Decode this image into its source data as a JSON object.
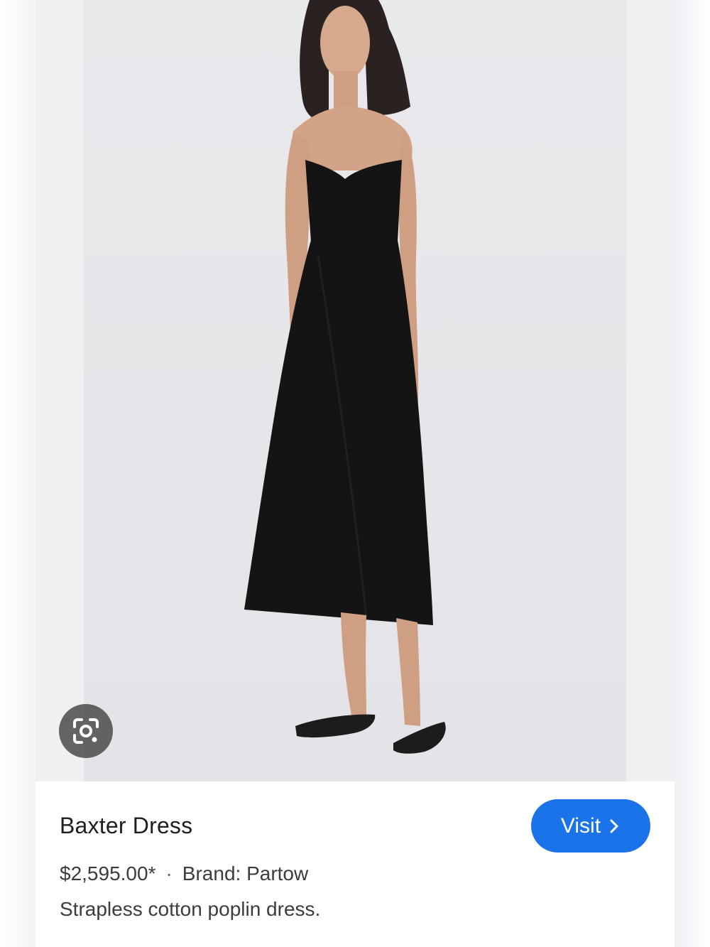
{
  "product": {
    "title": "Baxter Dress",
    "price": "$2,595.00*",
    "separator": "·",
    "brand": "Brand: Partow",
    "description": "Strapless cotton poplin dress."
  },
  "actions": {
    "visit_label": "Visit",
    "visit_icon": "chevron-right-icon",
    "lens_icon": "google-lens-icon"
  },
  "colors": {
    "accent": "#1a73e8",
    "lens_button_bg": "#505050",
    "dress": "#141414"
  }
}
